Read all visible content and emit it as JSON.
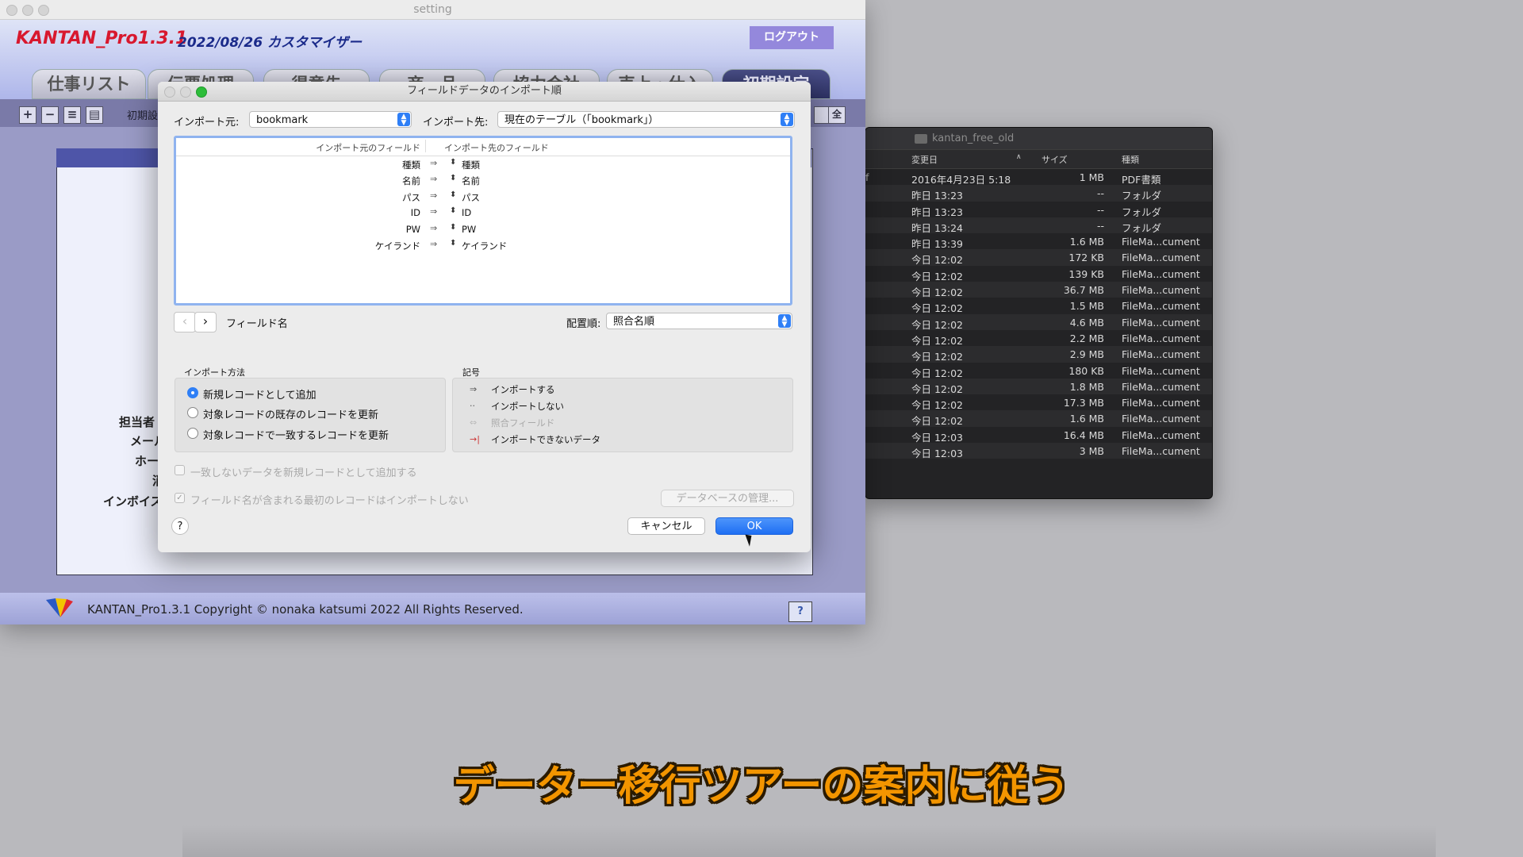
{
  "finder": {
    "folder_title": "kantan_free_old",
    "columns": [
      "変更日",
      "サイズ",
      "種類"
    ],
    "rows": [
      {
        "prefix": "f",
        "date": "2016年4月23日 5:18",
        "size": "1 MB",
        "kind": "PDF書類"
      },
      {
        "prefix": "",
        "date": "昨日 13:23",
        "size": "--",
        "kind": "フォルダ"
      },
      {
        "prefix": "",
        "date": "昨日 13:23",
        "size": "--",
        "kind": "フォルダ"
      },
      {
        "prefix": "",
        "date": "昨日 13:24",
        "size": "--",
        "kind": "フォルダ"
      },
      {
        "prefix": "",
        "date": "昨日 13:39",
        "size": "1.6 MB",
        "kind": "FileMa...cument"
      },
      {
        "prefix": "",
        "date": "今日 12:02",
        "size": "172 KB",
        "kind": "FileMa...cument"
      },
      {
        "prefix": "",
        "date": "今日 12:02",
        "size": "139 KB",
        "kind": "FileMa...cument"
      },
      {
        "prefix": "",
        "date": "今日 12:02",
        "size": "36.7 MB",
        "kind": "FileMa...cument"
      },
      {
        "prefix": "",
        "date": "今日 12:02",
        "size": "1.5 MB",
        "kind": "FileMa...cument"
      },
      {
        "prefix": "",
        "date": "今日 12:02",
        "size": "4.6 MB",
        "kind": "FileMa...cument"
      },
      {
        "prefix": "",
        "date": "今日 12:02",
        "size": "2.2 MB",
        "kind": "FileMa...cument"
      },
      {
        "prefix": "",
        "date": "今日 12:02",
        "size": "2.9 MB",
        "kind": "FileMa...cument"
      },
      {
        "prefix": "",
        "date": "今日 12:02",
        "size": "180 KB",
        "kind": "FileMa...cument"
      },
      {
        "prefix": "",
        "date": "今日 12:02",
        "size": "1.8 MB",
        "kind": "FileMa...cument"
      },
      {
        "prefix": "",
        "date": "今日 12:02",
        "size": "17.3 MB",
        "kind": "FileMa...cument"
      },
      {
        "prefix": "",
        "date": "今日 12:02",
        "size": "1.6 MB",
        "kind": "FileMa...cument"
      },
      {
        "prefix": "",
        "date": "今日 12:03",
        "size": "16.4 MB",
        "kind": "FileMa...cument"
      },
      {
        "prefix": "",
        "date": "今日 12:03",
        "size": "3 MB",
        "kind": "FileMa...cument"
      }
    ]
  },
  "app": {
    "window_title": "setting",
    "title": "KANTAN_Pro1.3.1",
    "subtitle": "2022/08/26 カスタマイザー",
    "logout": "ログアウト",
    "tabs": [
      "仕事リスト",
      "伝票処理",
      "得意先",
      "商　品",
      "協力会社",
      "売上・仕入",
      "初期設定"
    ],
    "toolbar_label": "初期設",
    "toolbar_right": "全",
    "side_labels": [
      "担当者",
      "メール",
      "ホー",
      "消",
      "インボイス"
    ],
    "footer_text": "KANTAN_Pro1.3.1  Copyright © nonaka katsumi 2022 All Rights Reserved.",
    "footer_help": "?"
  },
  "dialog": {
    "title": "フィールドデータのインポート順",
    "source_label": "インポート元:",
    "source_value": "bookmark",
    "target_label": "インポート先:",
    "target_value": "現在のテーブル（「bookmark」）",
    "col_source": "インポート元のフィールド",
    "col_target": "インポート先のフィールド",
    "mappings": [
      {
        "src": "種類",
        "dst": "種類"
      },
      {
        "src": "名前",
        "dst": "名前"
      },
      {
        "src": "パス",
        "dst": "パス"
      },
      {
        "src": "ID",
        "dst": "ID"
      },
      {
        "src": "PW",
        "dst": "PW"
      },
      {
        "src": "ケイランド",
        "dst": "ケイランド"
      }
    ],
    "field_name": "フィールド名",
    "order_label": "配置順:",
    "order_value": "照合名順",
    "method_title": "インポート方法",
    "methods": [
      "新規レコードとして追加",
      "対象レコードの既存のレコードを更新",
      "対象レコードで一致するレコードを更新"
    ],
    "symbols_title": "記号",
    "symbols": [
      "インポートする",
      "インポートしない",
      "照合フィールド",
      "インポートできないデータ"
    ],
    "option_add_unmatched": "一致しないデータを新規レコードとして追加する",
    "option_skip_first": "フィールド名が含まれる最初のレコードはインポートしない",
    "manage_db": "データベースの管理...",
    "help": "?",
    "cancel": "キャンセル",
    "ok": "OK"
  },
  "caption": "データー移行ツアーの案内に従う"
}
